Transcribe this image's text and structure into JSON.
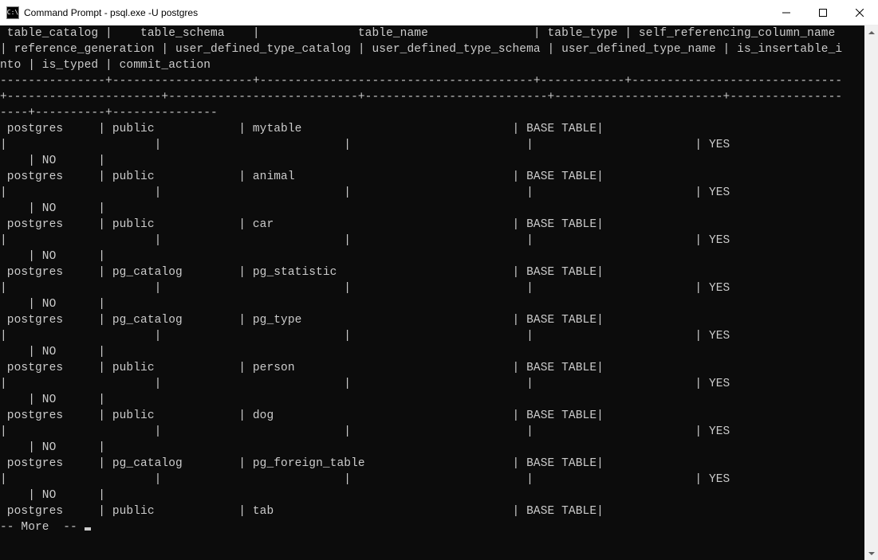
{
  "window": {
    "title": "Command Prompt - psql.exe  -U postgres",
    "icon_label": "C:\\"
  },
  "headers": {
    "line1": " table_catalog |    table_schema    |              table_name               | table_type | self_referencing_column_name ",
    "line2": "| reference_generation | user_defined_type_catalog | user_defined_type_schema | user_defined_type_name | is_insertable_i",
    "line3": "nto | is_typed | commit_action",
    "sep1": "---------------+--------------------+---------------------------------------+------------+------------------------------",
    "sep2": "+----------------------+---------------------------+--------------------------+------------------------+----------------",
    "sep3": "----+----------+---------------"
  },
  "rows": [
    {
      "catalog": "postgres",
      "schema": "public",
      "name": "mytable",
      "type": "BASE TABLE",
      "insertable": "YES",
      "typed": "NO"
    },
    {
      "catalog": "postgres",
      "schema": "public",
      "name": "animal",
      "type": "BASE TABLE",
      "insertable": "YES",
      "typed": "NO"
    },
    {
      "catalog": "postgres",
      "schema": "public",
      "name": "car",
      "type": "BASE TABLE",
      "insertable": "YES",
      "typed": "NO"
    },
    {
      "catalog": "postgres",
      "schema": "pg_catalog",
      "name": "pg_statistic",
      "type": "BASE TABLE",
      "insertable": "YES",
      "typed": "NO"
    },
    {
      "catalog": "postgres",
      "schema": "pg_catalog",
      "name": "pg_type",
      "type": "BASE TABLE",
      "insertable": "YES",
      "typed": "NO"
    },
    {
      "catalog": "postgres",
      "schema": "public",
      "name": "person",
      "type": "BASE TABLE",
      "insertable": "YES",
      "typed": "NO"
    },
    {
      "catalog": "postgres",
      "schema": "public",
      "name": "dog",
      "type": "BASE TABLE",
      "insertable": "YES",
      "typed": "NO"
    },
    {
      "catalog": "postgres",
      "schema": "pg_catalog",
      "name": "pg_foreign_table",
      "type": "BASE TABLE",
      "insertable": "YES",
      "typed": "NO"
    },
    {
      "catalog": "postgres",
      "schema": "public",
      "name": "tab",
      "type": "BASE TABLE",
      "insertable": "",
      "typed": ""
    }
  ],
  "pager": {
    "prompt": "-- More  -- "
  }
}
